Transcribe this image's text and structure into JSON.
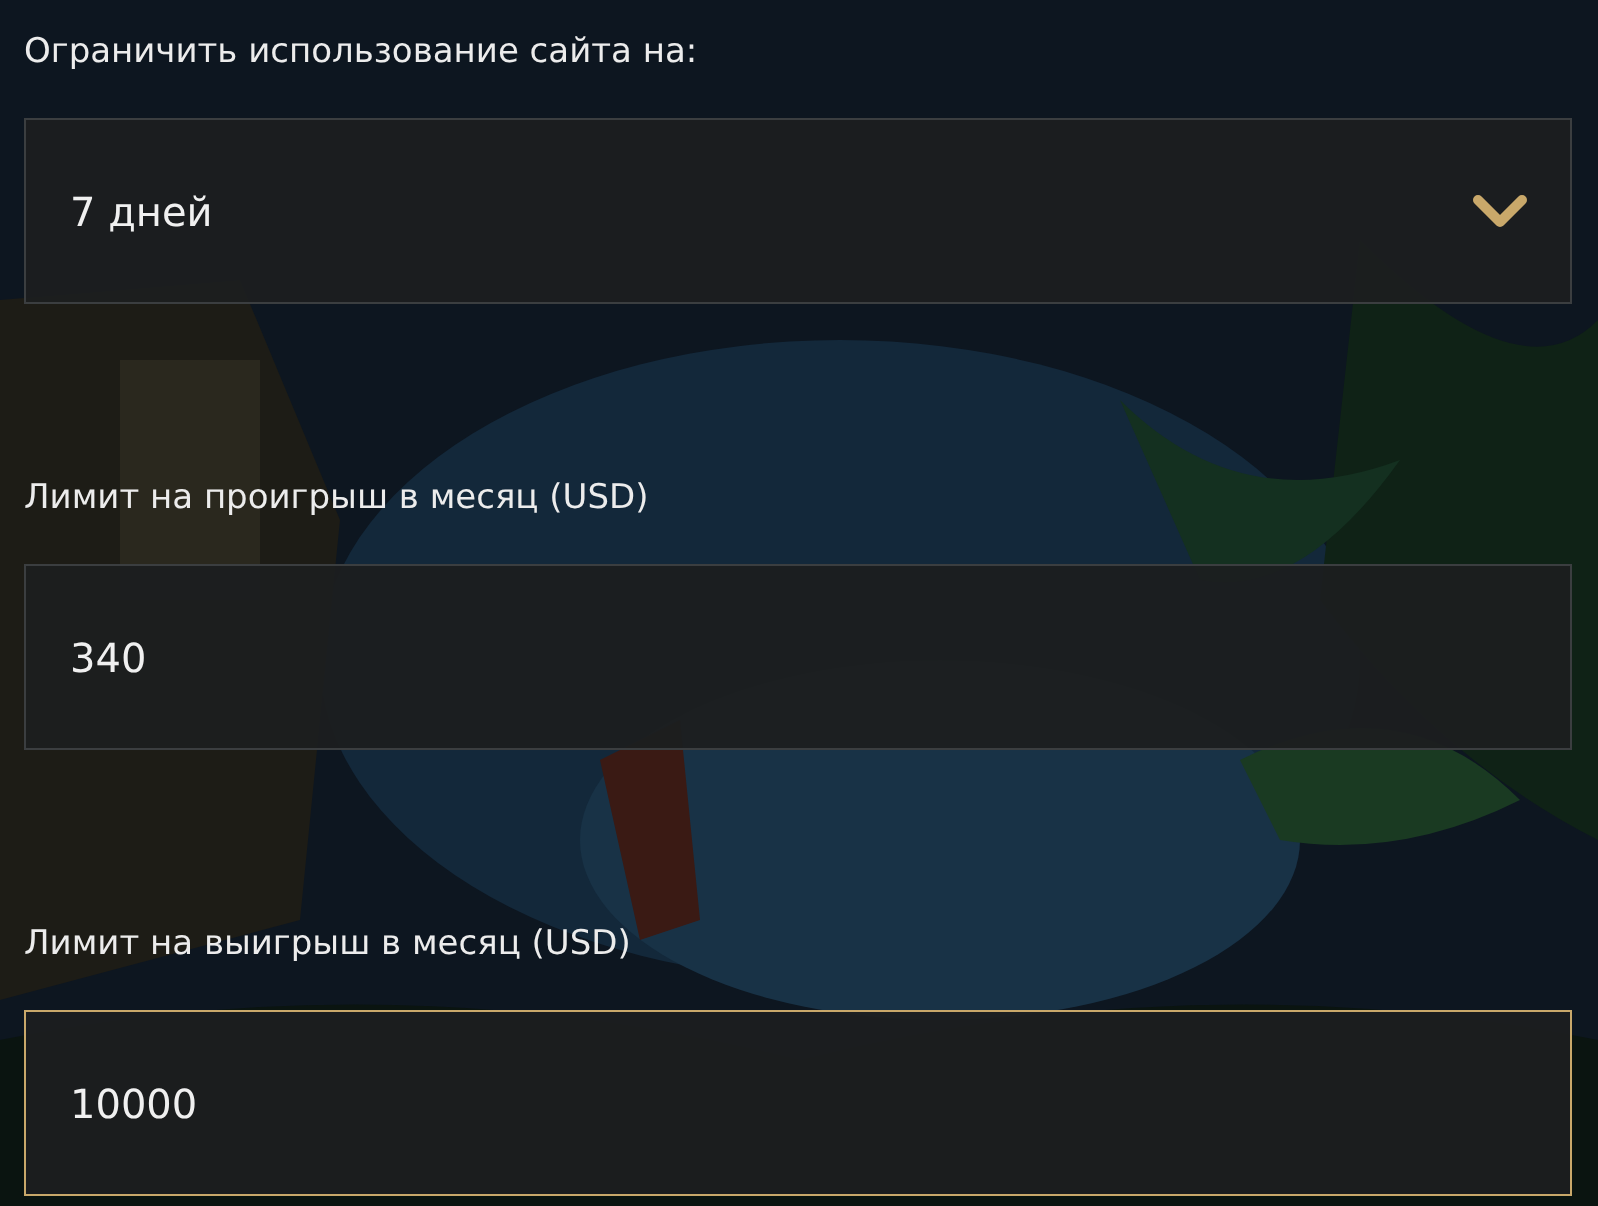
{
  "fields": [
    {
      "kind": "select",
      "label": "Ограничить использование сайта на:",
      "value": "7 дней",
      "focused": false
    },
    {
      "kind": "input",
      "label": "Лимит на проигрыш в месяц (USD)",
      "value": "340",
      "focused": false
    },
    {
      "kind": "input",
      "label": "Лимит на выигрыш в месяц (USD)",
      "value": "10000",
      "focused": true
    }
  ]
}
